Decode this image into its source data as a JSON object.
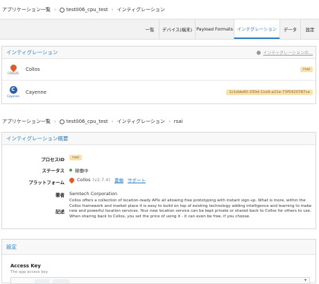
{
  "top_breadcrumb": [
    "アプリケーション一覧",
    "test006_cpu_test",
    "インティグレーション"
  ],
  "tabs": [
    "一覧",
    "デバイス(端末)",
    "Payload Formats",
    "インテグレーション",
    "データ",
    "設定"
  ],
  "integration_panel": {
    "title": "インティグレーション",
    "docs_link": "インティグレーションの…",
    "items": [
      {
        "name": "Collos",
        "logo_text": "COLLOS",
        "badge": "rsai"
      },
      {
        "name": "Cayenne",
        "logo_text": "Cayenne",
        "badge": "1c1dde60-330d-11e9-a21e-73f5420787ce"
      }
    ]
  },
  "second_breadcrumb": [
    "アプリケーション一覧",
    "test006_cpu_test",
    "インティグレーション",
    "rsai"
  ],
  "overview": {
    "title": "インティグレーション概要",
    "process_id_label": "プロセスID",
    "process_id": "rsai",
    "status_label": "ステータス",
    "status": "稼働中",
    "platform_label": "プラットフォーム",
    "platform_name": "Collos",
    "platform_version": "(v2.7.4)",
    "docs_link": "書類",
    "support_link": "サポート",
    "author_label": "著者",
    "author": "Semtech Corporation",
    "description_label": "記述",
    "description": "Collos offers a collection of location-ready APIs all allowing free prototyping with instant sign-up. What is more, within the Collos framework and market place it is easy to build on top of existing technology adding intelligence and learning to make new and powerful location services. Your new location service can be kept private or shared back to Collos for others to use. When sharing back to Collos, you set the price of using it - it can even be free, if you choose."
  },
  "settings": {
    "title": "設定",
    "access_key_label": "Access Key",
    "access_key_hint": "The app access key"
  },
  "colors": {
    "accent": "#2a7bbf",
    "status_green": "#3aa655",
    "badge_bg": "#f8e3b0"
  }
}
